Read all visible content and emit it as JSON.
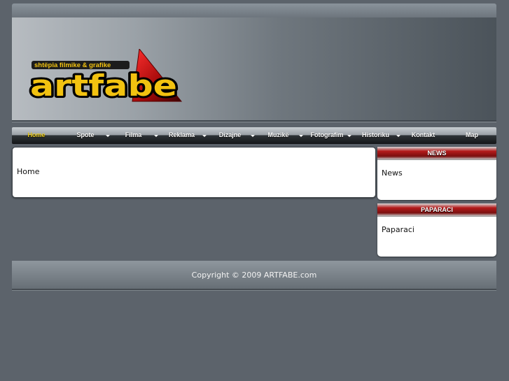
{
  "header": {
    "logo_text": "ARTFABE",
    "tagline": "shtëpia filmike & grafike"
  },
  "nav": {
    "items": [
      {
        "label": "Home",
        "active": true,
        "has_submenu": false
      },
      {
        "label": "Spote",
        "active": false,
        "has_submenu": true
      },
      {
        "label": "Filma",
        "active": false,
        "has_submenu": true
      },
      {
        "label": "Reklama",
        "active": false,
        "has_submenu": true
      },
      {
        "label": "Dizajne",
        "active": false,
        "has_submenu": true
      },
      {
        "label": "Muzikë",
        "active": false,
        "has_submenu": true
      },
      {
        "label": "Fotografim",
        "active": false,
        "has_submenu": true
      },
      {
        "label": "Historiku",
        "active": false,
        "has_submenu": true
      },
      {
        "label": "Kontakt",
        "active": false,
        "has_submenu": false
      },
      {
        "label": "Map",
        "active": false,
        "has_submenu": false
      }
    ]
  },
  "main": {
    "content_text": "Home"
  },
  "sidebar": {
    "news": {
      "title": "NEWS",
      "body": "News"
    },
    "paparaci": {
      "title": "PAPARACI",
      "body": "Paparaci"
    }
  },
  "footer": {
    "copyright": "Copyright © 2009 ARTFABE.com"
  },
  "colors": {
    "background": "#5c636b",
    "nav_active": "#f0d020",
    "side_title_red": "#b31b1b"
  }
}
